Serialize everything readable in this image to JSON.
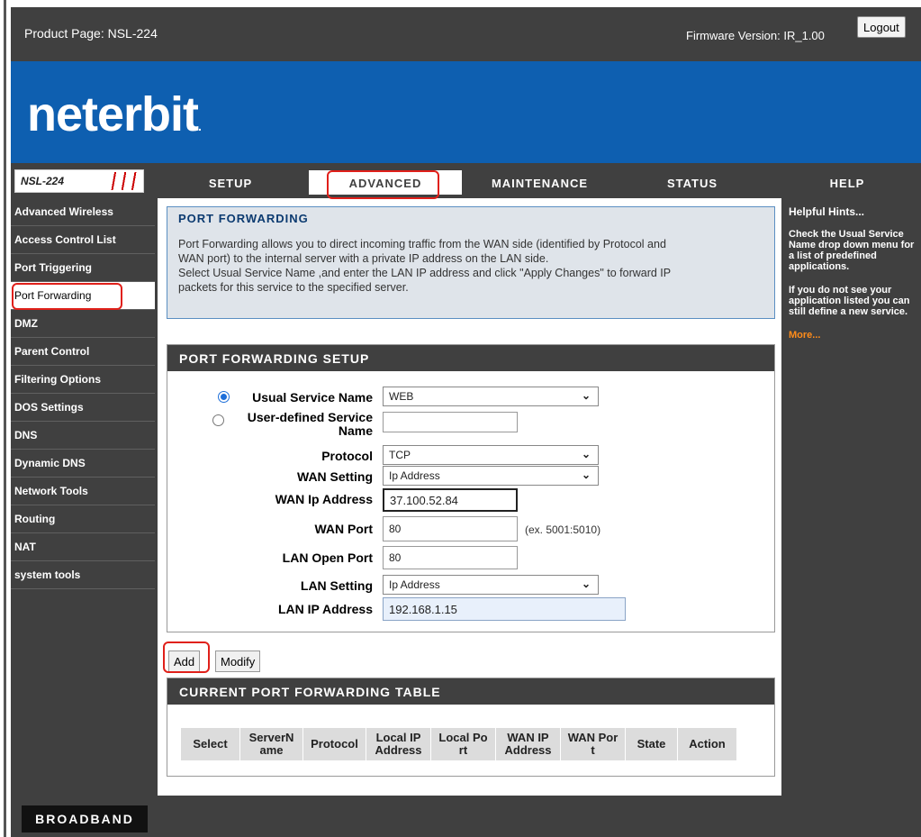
{
  "header": {
    "product": "Product Page: NSL-224",
    "firmware": "Firmware Version: IR_1.00",
    "logout": "Logout"
  },
  "logo": {
    "text": "neterbit",
    "dot": "."
  },
  "model": "NSL-224",
  "tabs": [
    "SETUP",
    "ADVANCED",
    "MAINTENANCE",
    "STATUS",
    "HELP"
  ],
  "active_tab": "ADVANCED",
  "sidebar": {
    "items": [
      "Advanced Wireless",
      "Access Control List",
      "Port Triggering",
      "Port Forwarding",
      "DMZ",
      "Parent Control",
      "Filtering Options",
      "DOS Settings",
      "DNS",
      "Dynamic DNS",
      "Network Tools",
      "Routing",
      "NAT",
      "system tools"
    ],
    "active": "Port Forwarding"
  },
  "intro": {
    "title": "PORT FORWARDING",
    "line1": "Port Forwarding allows you to direct incoming traffic from the WAN side (identified by Protocol and",
    "line2": "WAN port) to the internal server with a private IP address on the LAN side.",
    "line3": "Select Usual Service Name ,and enter the LAN IP address and click \"Apply Changes\" to forward IP",
    "line4": "packets for this service to the specified server."
  },
  "setup": {
    "title": "PORT FORWARDING SETUP",
    "usual_service_label": "Usual Service Name",
    "usual_service_value": "WEB",
    "user_defined_label_1": "User-defined Service",
    "user_defined_label_2": "Name",
    "user_defined_value": "",
    "protocol_label": "Protocol",
    "protocol_value": "TCP",
    "wan_setting_label": "WAN Setting",
    "wan_setting_value": "Ip Address",
    "wan_ip_label": "WAN Ip Address",
    "wan_ip_value": "37.100.52.84",
    "wan_port_label": "WAN Port",
    "wan_port_value": "80",
    "wan_port_hint": "(ex. 5001:5010)",
    "lan_open_port_label": "LAN Open Port",
    "lan_open_port_value": "80",
    "lan_setting_label": "LAN Setting",
    "lan_setting_value": "Ip Address",
    "lan_ip_label": "LAN IP Address",
    "lan_ip_value": "192.168.1.15"
  },
  "buttons": {
    "add": "Add",
    "modify": "Modify"
  },
  "table": {
    "title": "CURRENT PORT FORWARDING TABLE",
    "columns": [
      [
        "Select"
      ],
      [
        "ServerN",
        "ame"
      ],
      [
        "Protocol"
      ],
      [
        "Local IP",
        "Address"
      ],
      [
        "Local Po",
        "rt"
      ],
      [
        "WAN IP",
        "Address"
      ],
      [
        "WAN Por",
        "t"
      ],
      [
        "State"
      ],
      [
        "Action"
      ]
    ]
  },
  "hints": {
    "title": "Helpful Hints...",
    "p1": "Check the Usual Service Name drop down menu for a list of predefined applications.",
    "p2": "If you do not see your application listed you can still define a new service.",
    "more": "More..."
  },
  "footer": {
    "brand": "BROADBAND"
  },
  "colors": {
    "frame": "#404040",
    "banner": "#0e5fb0",
    "highlight": "#e0201a",
    "more": "#ff8c1a"
  }
}
